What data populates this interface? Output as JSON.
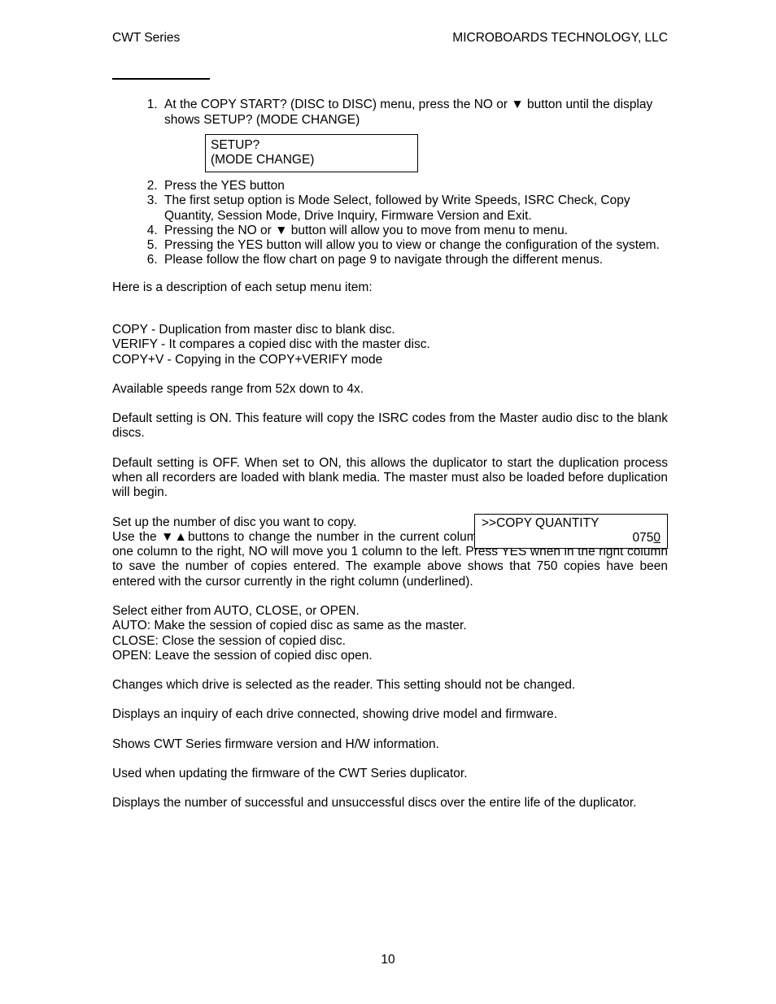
{
  "header": {
    "left": "CWT Series",
    "right": "MICROBOARDS TECHNOLOGY, LLC"
  },
  "steps": {
    "s1a": "At the COPY START? (DISC to DISC) menu, press the NO or ",
    "s1b": " button until the display shows SETUP? (MODE CHANGE)",
    "lcd1_line1": "  SETUP?",
    "lcd1_line2": "(MODE CHANGE)",
    "s2": "Press the YES button",
    "s3": "The first setup option is Mode Select, followed by Write Speeds, ISRC Check, Copy Quantity, Session Mode, Drive Inquiry, Firmware Version and Exit.",
    "s4a": "Pressing the NO or ",
    "s4b": " button will allow you to move from menu to menu.",
    "s5": "Pressing the YES button will allow you to view or change the configuration of the system.",
    "s6": "Please follow the flow chart on page 9 to navigate through the different menus."
  },
  "intro": "Here is a description of each setup menu item:",
  "descs": {
    "copy": "COPY - Duplication from master disc to blank disc.",
    "verify": "VERIFY - It compares a copied disc with the master disc.",
    "copyv": "COPY+V - Copying in the COPY+VERIFY mode",
    "speeds": "Available speeds range from 52x down to 4x.",
    "isrc": "Default setting is ON.  This feature will copy the ISRC codes from the Master audio disc to the blank discs.",
    "autorun": "Default setting is OFF.  When set to ON, this allows the duplicator to start the duplication process when all recorders are loaded with blank media.  The master must also be loaded before duplication will begin.",
    "qty_intro": "Set up the number of disc you want to copy.",
    "lcd2_line1": ">>COPY QUANTITY",
    "lcd2_num_a": "075",
    "lcd2_num_b": "0",
    "qty_body_a": "Use the ",
    "qty_body_b": "buttons to change the number in the current column up or down.  YES will move you one column to the right, NO will move you 1 column to the left.  Press YES when in the right column to save the number of copies entered.  The example above shows that 750 copies have been entered with the cursor currently in the right column (underlined).",
    "session1": "Select either from AUTO, CLOSE, or OPEN.",
    "session2": "AUTO: Make the session of copied disc as same as the master.",
    "session3": "CLOSE: Close the session of copied disc.",
    "session4": "OPEN: Leave the session of copied disc open.",
    "reader": "Changes which drive is selected as the reader.  This setting should not be changed.",
    "inquiry": "Displays an inquiry of each drive connected, showing drive model and firmware.",
    "fw": "Shows CWT Series firmware version and H/W information.",
    "update": "Used when updating the firmware of the CWT Series duplicator.",
    "history": "Displays the number of successful and unsuccessful discs over the entire life of the duplicator."
  },
  "page_number": "10"
}
